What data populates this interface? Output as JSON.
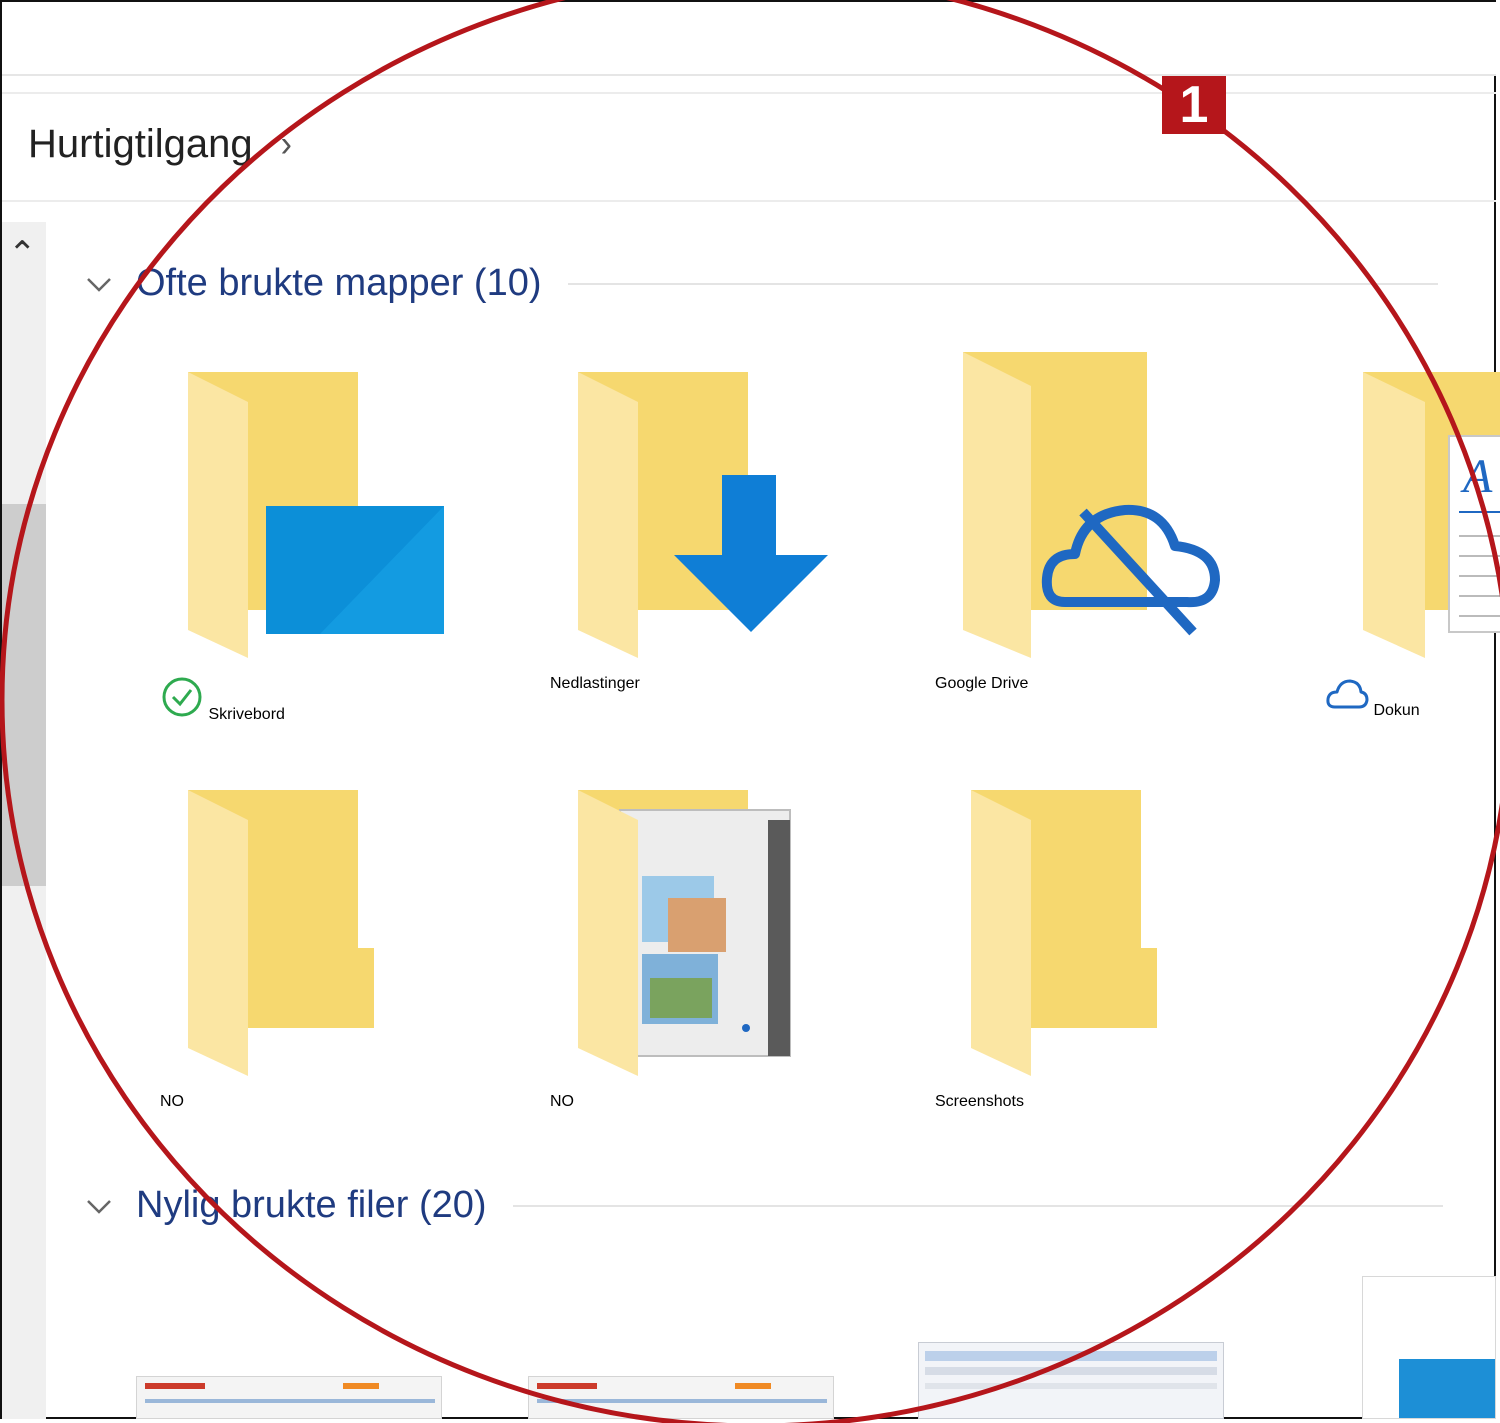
{
  "breadcrumb": {
    "location": "Hurtigtilgang",
    "separator": "›"
  },
  "sections": {
    "frequent": {
      "title": "Ofte brukte mapper (10)"
    },
    "recent": {
      "title": "Nylig brukte filer (20)"
    }
  },
  "folders": [
    {
      "label": "Skrivebord",
      "status_icon": "synced-check-icon",
      "overlay": "desktop"
    },
    {
      "label": "Nedlastinger",
      "overlay": "download-arrow"
    },
    {
      "label": "Google Drive",
      "overlay": "cloud-offline"
    },
    {
      "label": "Dokun",
      "status_icon": "cloud-icon",
      "overlay": "document"
    },
    {
      "label": "NO",
      "overlay": "none"
    },
    {
      "label": "NO",
      "overlay": "pictures"
    },
    {
      "label": "Screenshots",
      "overlay": "none"
    }
  ],
  "annotation": {
    "number": "1",
    "color": "#b5161b"
  },
  "colors": {
    "folder": "#f7d56b",
    "accent_blue": "#0f7ed6",
    "section_title": "#1f3b80",
    "sync_green": "#2eaa4f"
  }
}
